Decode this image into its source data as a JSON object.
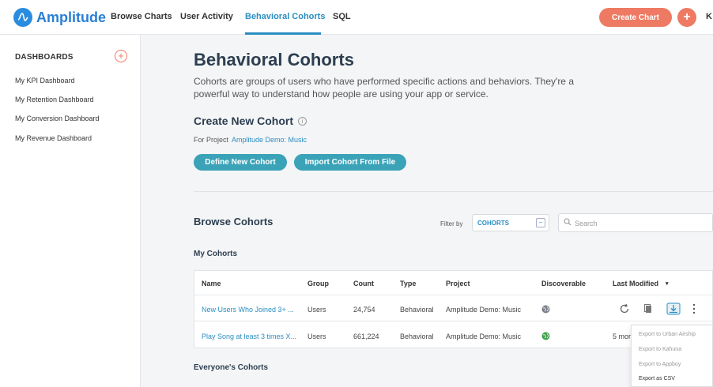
{
  "nav": {
    "brand": "Amplitude",
    "items": [
      "Browse Charts",
      "User Activity",
      "Behavioral Cohorts",
      "SQL"
    ],
    "create_chart": "Create Chart",
    "plus": "+",
    "trailing": "K"
  },
  "sidebar": {
    "title": "DASHBOARDS",
    "add": "+",
    "items": [
      "My KPI Dashboard",
      "My Retention Dashboard",
      "My Conversion Dashboard",
      "My Revenue Dashboard"
    ]
  },
  "main": {
    "title": "Behavioral Cohorts",
    "description": "Cohorts are groups of users who have performed specific actions and behaviors. They're a powerful way to understand how people are using your app or service.",
    "create_title": "Create New Cohort",
    "for_project_label": "For Project",
    "project_name": "Amplitude Demo: Music",
    "define_button": "Define New Cohort",
    "import_button": "Import Cohort From File",
    "browse_title": "Browse Cohorts",
    "filter_label": "Filter by",
    "filter_value": "COHORTS",
    "search_placeholder": "Search",
    "my_cohorts": "My Cohorts",
    "everyone_cohorts": "Everyone's Cohorts"
  },
  "table": {
    "headers": {
      "name": "Name",
      "group": "Group",
      "count": "Count",
      "type": "Type",
      "project": "Project",
      "discoverable": "Discoverable",
      "last_modified": "Last Modified",
      "sort": "▾"
    },
    "rows": [
      {
        "name": "New Users Who Joined 3+ ...",
        "group": "Users",
        "count": "24,754",
        "type": "Behavioral",
        "project": "Amplitude Demo: Music",
        "discoverable_color": "#7a8088",
        "last_modified": ""
      },
      {
        "name": "Play Song at least 3 times X...",
        "group": "Users",
        "count": "661,224",
        "type": "Behavioral",
        "project": "Amplitude Demo: Music",
        "discoverable_color": "#3fa14a",
        "last_modified": "5 mor"
      }
    ]
  },
  "export_menu": {
    "items": [
      "Export to Urban Airship",
      "Export to Kahuna",
      "Export to Appboy",
      "Export as CSV"
    ]
  },
  "colors": {
    "accent": "#2a8ec2",
    "cta": "#ee7a63",
    "pill": "#3aa3b8"
  }
}
